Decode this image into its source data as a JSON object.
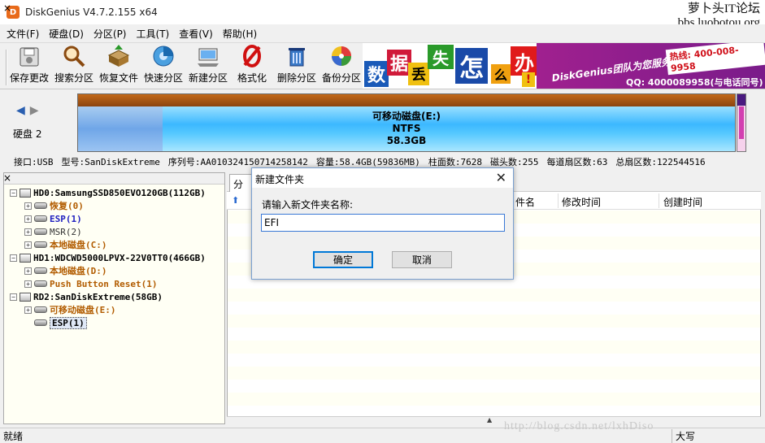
{
  "window": {
    "title": "DiskGenius V4.7.2.155 x64",
    "app_icon": "D"
  },
  "watermark_top": {
    "line1": "萝卜头IT论坛",
    "line2": "bbs.luobotou.org"
  },
  "menu": [
    "文件(F)",
    "硬盘(D)",
    "分区(P)",
    "工具(T)",
    "查看(V)",
    "帮助(H)"
  ],
  "toolbar": [
    {
      "label": "保存更改",
      "icon": "save-icon"
    },
    {
      "label": "搜索分区",
      "icon": "search-partition-icon"
    },
    {
      "label": "恢复文件",
      "icon": "recover-file-icon"
    },
    {
      "label": "快速分区",
      "icon": "quick-partition-icon"
    },
    {
      "label": "新建分区",
      "icon": "new-partition-icon"
    },
    {
      "label": "格式化",
      "icon": "format-icon"
    },
    {
      "label": "删除分区",
      "icon": "delete-partition-icon"
    },
    {
      "label": "备份分区",
      "icon": "backup-partition-icon"
    }
  ],
  "banner": {
    "tiles": [
      "数",
      "据",
      "丢",
      "失",
      "怎",
      "么",
      "办",
      "!"
    ],
    "brand": "DiskGenius团队为您服务",
    "phone_label": "热线: 400-008-9958",
    "qq": "QQ: 4000089958(与电话同号)"
  },
  "disk_panel": {
    "disk_label": "硬盘 2",
    "partition_name": "可移动磁盘(E:)",
    "filesystem": "NTFS",
    "size": "58.3GB"
  },
  "disk_info": {
    "interface": "接口:USB",
    "model": "型号:SanDiskExtreme",
    "serial": "序列号:AA010324150714258142",
    "capacity": "容量:58.4GB(59836MB)",
    "cylinders": "柱面数:7628",
    "heads": "磁头数:255",
    "sectors_per_track": "每道扇区数:63",
    "total_sectors": "总扇区数:122544516"
  },
  "tree": [
    {
      "level": 0,
      "kind": "disk",
      "label": "HD0:SamsungSSD850EVO120GB(112GB)",
      "style": "c-dark"
    },
    {
      "level": 1,
      "kind": "part",
      "label": "恢复(0)",
      "style": "c-orange"
    },
    {
      "level": 1,
      "kind": "part",
      "label": "ESP(1)",
      "style": "c-blue"
    },
    {
      "level": 1,
      "kind": "part",
      "label": "MSR(2)",
      "style": "c-norm"
    },
    {
      "level": 1,
      "kind": "part",
      "label": "本地磁盘(C:)",
      "style": "c-orange"
    },
    {
      "level": 0,
      "kind": "disk",
      "label": "HD1:WDCWD5000LPVX-22V0TT0(466GB)",
      "style": "c-dark"
    },
    {
      "level": 1,
      "kind": "part",
      "label": "本地磁盘(D:)",
      "style": "c-orange"
    },
    {
      "level": 1,
      "kind": "part",
      "label": "Push Button Reset(1)",
      "style": "c-orange"
    },
    {
      "level": 0,
      "kind": "disk",
      "label": "RD2:SanDiskExtreme(58GB)",
      "style": "c-dark"
    },
    {
      "level": 1,
      "kind": "part",
      "label": "可移动磁盘(E:)",
      "style": "c-orange"
    },
    {
      "level": 1,
      "kind": "part",
      "label": "ESP(1)",
      "style": "c-dark",
      "selected": true
    }
  ],
  "right_panel": {
    "tab_label": "分区",
    "columns": [
      "件名",
      "修改时间",
      "创建时间"
    ]
  },
  "dialog": {
    "title": "新建文件夹",
    "prompt": "请输入新文件夹名称:",
    "input_value": "EFI",
    "ok_label": "确定",
    "cancel_label": "取消"
  },
  "status": {
    "text": "就绪",
    "caps": "大写"
  },
  "watermark_bottom": "http://blog.csdn.net/lxhDiso"
}
